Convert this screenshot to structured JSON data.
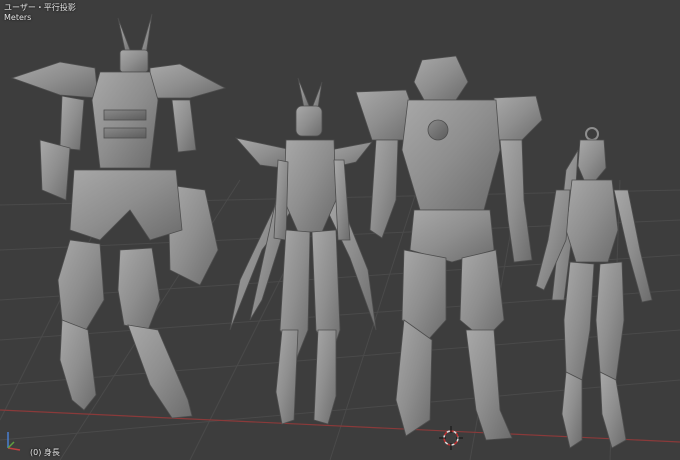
{
  "viewport": {
    "view_label": "ユーザー・平行投影",
    "units_label": "Meters",
    "active_object_label": "(0) 身長",
    "background_color": "#3d3d3d",
    "grid_color": "#4a4a4a",
    "x_axis_color": "#8a3a3a",
    "model_color": "#8e8e8e"
  },
  "scene": {
    "objects": [
      {
        "name": "mecha-armored-model"
      },
      {
        "name": "winged-mecha-model"
      },
      {
        "name": "bulky-robot-model"
      },
      {
        "name": "female-android-model"
      }
    ],
    "cursor_icon": "3d-cursor-icon",
    "gizmo_icon": "axis-gizmo-icon"
  }
}
